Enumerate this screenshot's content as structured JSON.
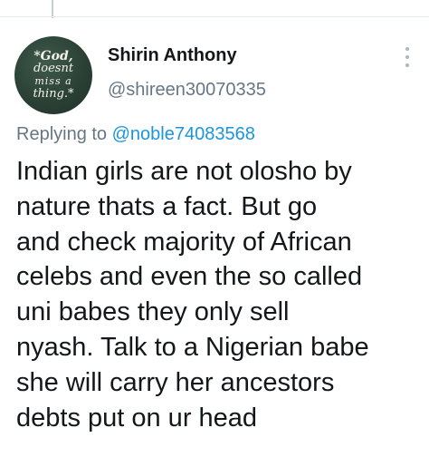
{
  "tweet": {
    "author_name": "Shirin Anthony",
    "handle": "@shireen30070335",
    "avatar_text": [
      "*God,",
      "doesnt",
      "miss a",
      "thing.*"
    ],
    "reply_prefix": "Replying to",
    "reply_mention": "@noble74083568",
    "text_lines": [
      "Indian girls are not olosho by",
      "nature thats a fact. But go",
      "and check majority of African",
      "celebs and even the so called",
      "uni babes they only sell",
      "nyash. Talk to a Nigerian babe",
      "she will carry her ancestors",
      "debts put on ur head"
    ]
  },
  "icons": {
    "more": "more-vertical-icon"
  },
  "colors": {
    "text": "#14171a",
    "secondary": "#657786",
    "link": "#1b95e0",
    "avatar_bg": "#2b4136"
  }
}
